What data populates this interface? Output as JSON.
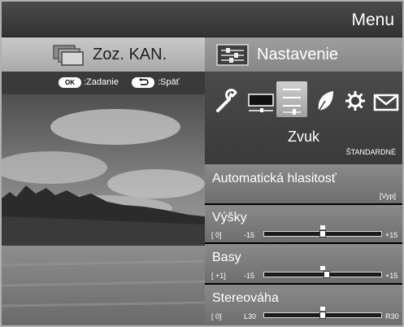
{
  "menu": {
    "title": "Menu"
  },
  "tabs": [
    {
      "label": "Zoz. KAN.",
      "icon": "channel-list-icon",
      "active": false
    },
    {
      "label": "Nastavenie",
      "icon": "settings-panel-icon",
      "active": true
    }
  ],
  "hints": [
    {
      "key": "OK",
      "label": ":Zadanie"
    },
    {
      "key": "back-icon",
      "label": ":Späť"
    }
  ],
  "category_icons": [
    "wrench-icon",
    "picture-icon",
    "sound-icon",
    "eco-leaf-icon",
    "gear-icon",
    "mail-icon"
  ],
  "selected_category": "sound-icon",
  "section": {
    "title": "Zvuk",
    "preset": "ŠTANDARDNÉ"
  },
  "rows": [
    {
      "title": "Automatická hlasitosť",
      "value": "[Vyp]"
    },
    {
      "title": "Výšky",
      "value_text": "[   0]",
      "min_label": "-15",
      "max_label": "+15",
      "value": 0,
      "min": -15,
      "max": 15
    },
    {
      "title": "Basy",
      "value_text": "[ +1]",
      "min_label": "-15",
      "max_label": "+15",
      "value": 1,
      "min": -15,
      "max": 15
    },
    {
      "title": "Stereováha",
      "value_text": "[   0]",
      "min_label": "L30",
      "max_label": "R30",
      "value": 0,
      "min": -30,
      "max": 30
    }
  ],
  "colors": {
    "menu_bar": "#3d3d3d",
    "tab_inactive": "#b9b9b9",
    "tab_active": "#929292",
    "row_bg": "#7c7c7c"
  }
}
